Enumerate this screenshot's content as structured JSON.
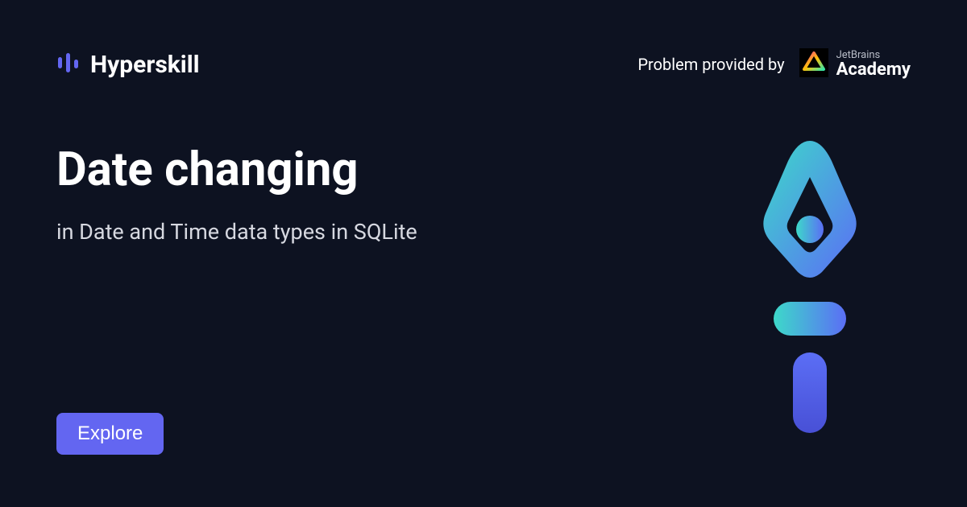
{
  "header": {
    "brand_name": "Hyperskill",
    "provider_label": "Problem provided by",
    "academy_small": "JetBrains",
    "academy_big": "Academy"
  },
  "content": {
    "title": "Date changing",
    "subtitle": "in Date and Time data types in SQLite"
  },
  "cta": {
    "explore_label": "Explore"
  }
}
